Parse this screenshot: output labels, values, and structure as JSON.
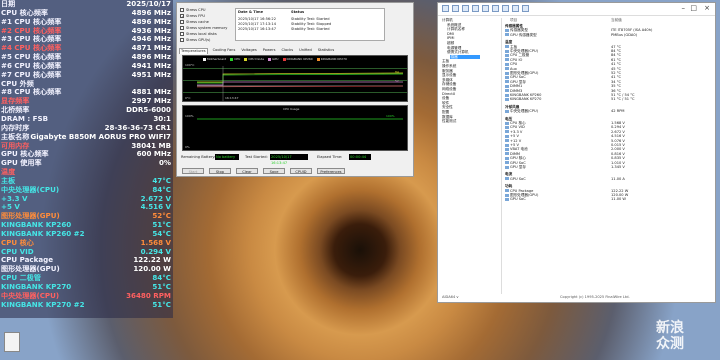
{
  "osd": {
    "rows": [
      {
        "label": "日期",
        "value": "2025/10/17",
        "lc": "#f2f2ff",
        "vc": "#ffffff"
      },
      {
        "label": "CPU 核心频率",
        "value": "4896 MHz",
        "lc": "#f2f2ff",
        "vc": "#ffffff"
      },
      {
        "label": "#1 CPU 核心频率",
        "value": "4896 MHz",
        "lc": "#f2f2ff",
        "vc": "#ffffff"
      },
      {
        "label": "#2 CPU 核心频率",
        "value": "4936 MHz",
        "lc": "#ff6060",
        "vc": "#ffffff"
      },
      {
        "label": "#3 CPU 核心频率",
        "value": "4946 MHz",
        "lc": "#f2f2ff",
        "vc": "#ffffff"
      },
      {
        "label": "#4 CPU 核心频率",
        "value": "4871 MHz",
        "lc": "#ff6060",
        "vc": "#ffffff"
      },
      {
        "label": "#5 CPU 核心频率",
        "value": "4896 MHz",
        "lc": "#f2f2ff",
        "vc": "#ffffff"
      },
      {
        "label": "#6 CPU 核心频率",
        "value": "4941 MHz",
        "lc": "#f2f2ff",
        "vc": "#ffffff"
      },
      {
        "label": "#7 CPU 核心频率",
        "value": "4951 MHz",
        "lc": "#f2f2ff",
        "vc": "#ffffff"
      },
      {
        "label": "CPU 外频",
        "value": "",
        "lc": "#f2f2ff",
        "vc": "#ffffff"
      },
      {
        "label": "#8 CPU 核心频率",
        "value": "4881 MHz",
        "lc": "#f2f2ff",
        "vc": "#ffffff"
      },
      {
        "label": "显存频率",
        "value": "2997 MHz",
        "lc": "#ff6060",
        "vc": "#ffffff"
      },
      {
        "label": "北桥频率",
        "value": "DDR5-6000",
        "lc": "#f2f2ff",
        "vc": "#ffffff"
      },
      {
        "label": "DRAM : FSB",
        "value": "30:1",
        "lc": "#f2f2ff",
        "vc": "#ffffff"
      },
      {
        "label": "内存时序",
        "value": "28-36-36-73 CR1",
        "lc": "#f2f2ff",
        "vc": "#ffffff"
      },
      {
        "label": "主板名称",
        "value": "Gigabyte B850M AORUS PRO WIFI7",
        "lc": "#f2f2ff",
        "vc": "#ffffff"
      },
      {
        "label": "可用内存",
        "value": "38041 MB",
        "lc": "#ff6060",
        "vc": "#ffffff"
      },
      {
        "label": "GPU 核心频率",
        "value": "600 MHz",
        "lc": "#f2f2ff",
        "vc": "#ffffff"
      },
      {
        "label": "GPU 使用率",
        "value": "0%",
        "lc": "#f2f2ff",
        "vc": "#ffffff"
      },
      {
        "label": "温度",
        "value": "",
        "lc": "#ff6060",
        "vc": "#ffffff"
      },
      {
        "label": "主板",
        "value": "47°C",
        "lc": "#45e6e6",
        "vc": "#45e6e6"
      },
      {
        "label": "中央处理器(CPU)",
        "value": "84°C",
        "lc": "#45e6e6",
        "vc": "#45e6e6"
      },
      {
        "label": "+3.3 V",
        "value": "2.672 V",
        "lc": "#45e6e6",
        "vc": "#45e6e6"
      },
      {
        "label": "+5 V",
        "value": "4.516 V",
        "lc": "#45e6e6",
        "vc": "#45e6e6"
      },
      {
        "label": "图形处理器(GPU)",
        "value": "52°C",
        "lc": "#ff8c3a",
        "vc": "#ff8c3a"
      },
      {
        "label": "KINGBANK KP260",
        "value": "51°C",
        "lc": "#45e6e6",
        "vc": "#45e6e6"
      },
      {
        "label": "KINGBANK KP260 #2",
        "value": "54°C",
        "lc": "#45e6e6",
        "vc": "#45e6e6"
      },
      {
        "label": "CPU 核心",
        "value": "1.568 V",
        "lc": "#ff8c3a",
        "vc": "#ff8c3a"
      },
      {
        "label": "CPU VID",
        "value": "0.294 V",
        "lc": "#45e6e6",
        "vc": "#45e6e6"
      },
      {
        "label": "CPU Package",
        "value": "122.22 W",
        "lc": "#f2f2ff",
        "vc": "#ffffff"
      },
      {
        "label": "图形处理器(GPU)",
        "value": "120.00 W",
        "lc": "#f2f2ff",
        "vc": "#ffffff"
      },
      {
        "label": "CPU 二极管",
        "value": "84°C",
        "lc": "#45e6e6",
        "vc": "#45e6e6"
      },
      {
        "label": "KINGBANK KP270",
        "value": "51°C",
        "lc": "#45e6e6",
        "vc": "#45e6e6"
      },
      {
        "label": "中央处理器(CPU)",
        "value": "36480 RPM",
        "lc": "#ff6060",
        "vc": "#ff6060"
      },
      {
        "label": "KINGBANK KP270 #2",
        "value": "51°C",
        "lc": "#45e6e6",
        "vc": "#45e6e6"
      }
    ]
  },
  "stability": {
    "checks": [
      "Stress CPU",
      "Stress FPU",
      "Stress cache",
      "Stress system memory",
      "Stress local disks",
      "Stress GPU(s)"
    ],
    "checked": [
      false,
      true,
      false,
      false,
      false,
      false
    ],
    "log_head": [
      "Date & Time",
      "Status"
    ],
    "log": [
      {
        "time": "2025/10/17 16:56:22",
        "status": "Stability Test: Started"
      },
      {
        "time": "2025/10/17 17:13:14",
        "status": "Stability Test: Stopped"
      },
      {
        "time": "2025/10/17 16:13:47",
        "status": "Stability Test: Started"
      }
    ],
    "tabs": [
      "Temperatures",
      "Cooling Fans",
      "Voltages",
      "Powers",
      "Clocks",
      "Unified",
      "Statistics"
    ],
    "legend": [
      "Motherboard",
      "CPU",
      "CPU Diode",
      "GPU",
      "KINGBANK KP260",
      "KINGBANK KP270"
    ],
    "legend_colors": [
      "#f4f4f4",
      "#29d129",
      "#d6d629",
      "#d18ad1",
      "#e23a3a",
      "#f08f2a"
    ],
    "temp_axis": [
      "100°C",
      "0°C"
    ],
    "time_tag": "16:13:47",
    "temp_tags": [
      "84",
      "52"
    ],
    "usage_title": "CPU Usage",
    "usage_axis": [
      "100%",
      "0%"
    ],
    "usage_tags": [
      "100%",
      "100%"
    ],
    "battery_label": "Remaining Battery:",
    "battery_value": "No battery",
    "start_label": "Test Started:",
    "start_value": "2025/10/17 16:13:47",
    "elapsed_label": "Elapsed Time:",
    "elapsed_value": "00:00:44",
    "buttons": [
      "Start",
      "Stop",
      "Clear",
      "Save",
      "CPUID",
      "Preferences"
    ]
  },
  "hwinfo": {
    "tree": [
      "计算机",
      "系统概述",
      "计算机名称",
      "DMI",
      "IPMI",
      "超频",
      "电源管理",
      "便携式计算机",
      "传感器",
      "主板",
      "操作系统",
      "服务器",
      "显示设备",
      "多媒体",
      "存储设备",
      "网络设备",
      "DirectX",
      "设备",
      "软件",
      "安全性",
      "配置",
      "数据库",
      "性能测试"
    ],
    "sections": [
      {
        "cat": "传感器属性",
        "items": [
          {
            "k": "传感器类型",
            "v": "ITE IT8705F  (ISA A40h)"
          },
          {
            "k": "GPU 传感器类型",
            "v": "PMBus  (GDA0)"
          }
        ]
      },
      {
        "cat": "温度",
        "items": [
          {
            "k": "主板",
            "v": "47 °C"
          },
          {
            "k": "中央处理器(CPU)",
            "v": "84 °C"
          },
          {
            "k": "CPU 二极管",
            "v": "84 °C"
          },
          {
            "k": "CPU IO",
            "v": "61 °C"
          },
          {
            "k": "CPU",
            "v": "41 °C"
          },
          {
            "k": "Aux",
            "v": "45 °C"
          },
          {
            "k": "图形处理器(GPU)",
            "v": "52 °C"
          },
          {
            "k": "GPU SoC",
            "v": "41 °C"
          },
          {
            "k": "GPU 显存",
            "v": "34 °C"
          },
          {
            "k": "DIMM1",
            "v": "35 °C"
          },
          {
            "k": "DIMM3",
            "v": "36 °C"
          },
          {
            "k": "KINGBANK KP260",
            "v": "51 °C / 54 °C"
          },
          {
            "k": "KINGBANK KP270",
            "v": "51 °C / 51 °C"
          }
        ]
      },
      {
        "cat": "冷却风扇",
        "items": [
          {
            "k": "中央处理器(CPU)",
            "v": "42 RPM"
          }
        ]
      },
      {
        "cat": "电压",
        "items": [
          {
            "k": "CPU 核心",
            "v": "1.568 V"
          },
          {
            "k": "CPU VID",
            "v": "0.294 V"
          },
          {
            "k": "+3.3 V",
            "v": "2.672 V"
          },
          {
            "k": "+5 V",
            "v": "4.516 V"
          },
          {
            "k": "+12 V",
            "v": "5.076 V"
          },
          {
            "k": "+5 V",
            "v": "0.015 V"
          },
          {
            "k": "VBAT 电池",
            "v": "2.000 V"
          },
          {
            "k": "DIMM",
            "v": "0.816 V"
          },
          {
            "k": "GPU 核心",
            "v": "0.835 V"
          },
          {
            "k": "GPU SoC",
            "v": "1.010 V"
          },
          {
            "k": "GPU 显存",
            "v": "1.345 V"
          }
        ]
      },
      {
        "cat": "电流",
        "items": [
          {
            "k": "GPU SoC",
            "v": "11.00 A"
          }
        ]
      },
      {
        "cat": "功耗",
        "items": [
          {
            "k": "CPU Package",
            "v": "122.22 W"
          },
          {
            "k": "图形处理器(GPU)",
            "v": "120.00 W"
          },
          {
            "k": "GPU SoC",
            "v": "11.00 W"
          }
        ]
      }
    ],
    "col_item": "项目",
    "col_value": "当前值",
    "status_left": "AIDA64 v",
    "status_right": "Copyright (c) 1995-2025 FinalWire Ltd."
  },
  "watermark": [
    "新",
    "浪",
    "众",
    "测"
  ]
}
